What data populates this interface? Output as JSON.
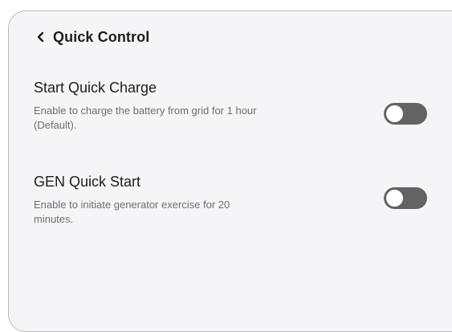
{
  "header": {
    "back_icon": "chevron-left-icon",
    "title": "Quick Control"
  },
  "settings": [
    {
      "title": "Start Quick Charge",
      "description": "Enable to charge the battery from grid for 1 hour (Default).",
      "enabled": false
    },
    {
      "title": "GEN Quick Start",
      "description": "Enable to initiate generator exercise for 20 minutes.",
      "enabled": false
    }
  ],
  "colors": {
    "panel_background": "#f5f5f7",
    "toggle_off": "#636366",
    "title_text": "#1d1d1f",
    "description_text": "#6e6e73"
  }
}
